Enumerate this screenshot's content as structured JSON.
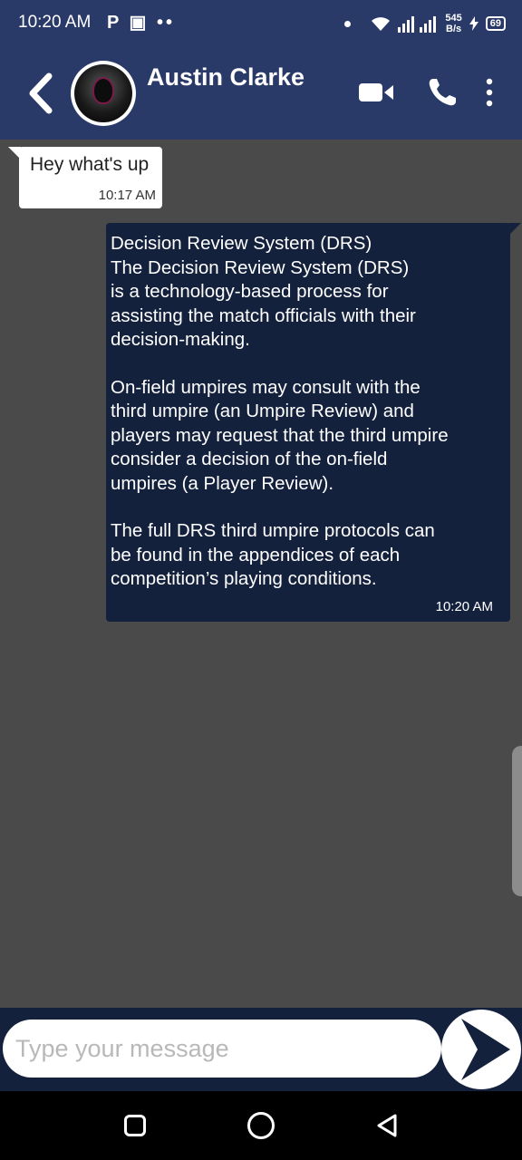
{
  "status_bar": {
    "time": "10:20 AM",
    "left_icons": "P ▣ ••",
    "net_speed_value": "545",
    "net_speed_unit": "B/s",
    "battery": "69"
  },
  "header": {
    "contact_name": "Austin Clarke",
    "icons": [
      "back-arrow-icon",
      "video-call-icon",
      "phone-icon",
      "more-vert-icon"
    ]
  },
  "messages": [
    {
      "direction": "incoming",
      "text": "Hey what's up",
      "time": "10:17 AM"
    },
    {
      "direction": "outgoing",
      "paragraphs": [
        "Decision Review System (DRS)\nThe Decision Review System (DRS)\nis a technology-based process for\nassisting the match officials with their\ndecision-making.",
        "On-field umpires may consult with the\nthird umpire (an Umpire Review) and\nplayers may request that the third umpire\nconsider a decision of the on-field\numpires (a Player Review).",
        "The full DRS third umpire protocols can\nbe found in the appendices of each\ncompetition’s playing conditions."
      ],
      "time": "10:20 AM"
    }
  ],
  "composer": {
    "placeholder": "Type your message",
    "value": ""
  },
  "colors": {
    "header_bg": "#2a3a68",
    "chat_bg": "#4a4a4a",
    "outgoing_bubble": "#14213d",
    "incoming_bubble": "#ffffff",
    "input_bar_bg": "#13213d"
  }
}
